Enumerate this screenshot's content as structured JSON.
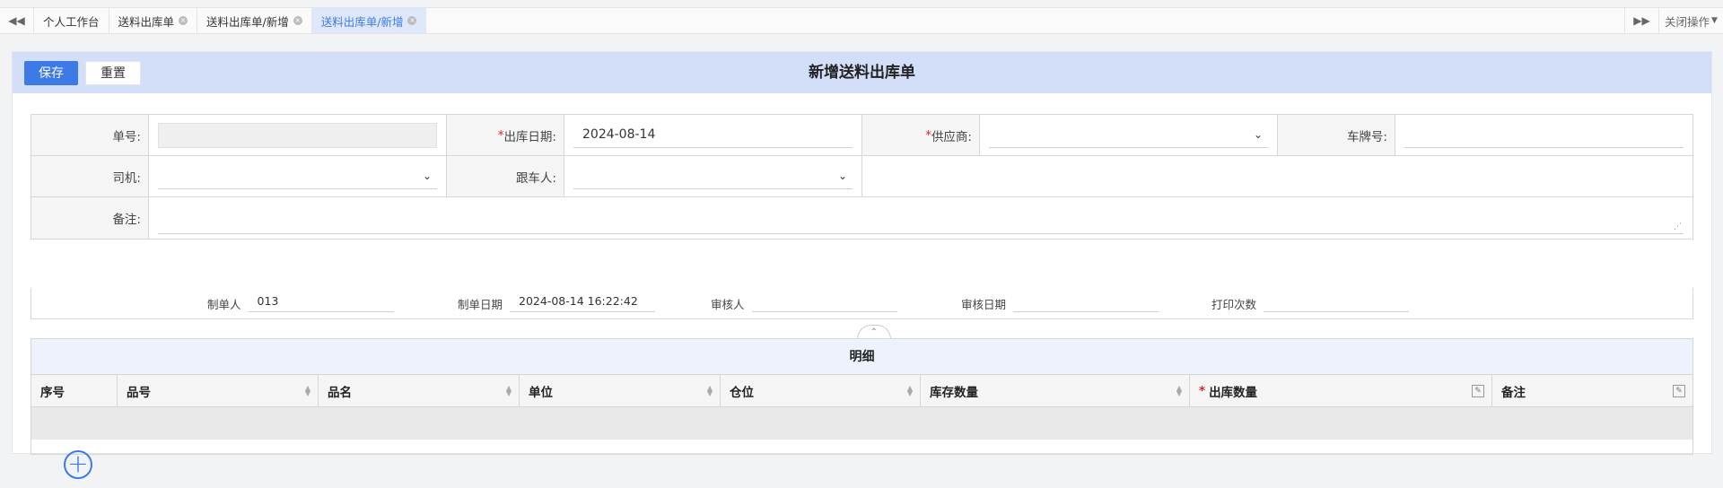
{
  "tabs": {
    "prev_icon": "double-left-icon",
    "items": [
      {
        "label": "个人工作台",
        "closable": false,
        "active": false
      },
      {
        "label": "送料出库单",
        "closable": true,
        "active": false
      },
      {
        "label": "送料出库单/新增",
        "closable": true,
        "active": false
      },
      {
        "label": "送料出库单/新增",
        "closable": true,
        "active": true
      }
    ],
    "next_icon": "double-right-icon",
    "close_ops_label": "关闭操作"
  },
  "toolbar": {
    "save_label": "保存",
    "reset_label": "重置",
    "title": "新增送料出库单"
  },
  "form": {
    "order_no": {
      "label": "单号:",
      "value": ""
    },
    "out_date": {
      "label": "出库日期:",
      "value": "2024-08-14",
      "required": true
    },
    "supplier": {
      "label": "供应商:",
      "value": "",
      "required": true
    },
    "plate_no": {
      "label": "车牌号:",
      "value": ""
    },
    "driver": {
      "label": "司机:",
      "value": ""
    },
    "escort": {
      "label": "跟车人:",
      "value": ""
    },
    "remark": {
      "label": "备注:",
      "value": ""
    }
  },
  "info": {
    "creator": {
      "label": "制单人",
      "value": "013"
    },
    "created_at": {
      "label": "制单日期",
      "value": "2024-08-14 16:22:42"
    },
    "reviewer": {
      "label": "审核人",
      "value": ""
    },
    "reviewed_at": {
      "label": "审核日期",
      "value": ""
    },
    "print_count": {
      "label": "打印次数",
      "value": ""
    }
  },
  "detail": {
    "title": "明细",
    "columns": [
      {
        "label": "序号",
        "sortable": false,
        "editable": false,
        "required": false
      },
      {
        "label": "品号",
        "sortable": true,
        "editable": false,
        "required": false
      },
      {
        "label": "品名",
        "sortable": true,
        "editable": false,
        "required": false
      },
      {
        "label": "单位",
        "sortable": true,
        "editable": false,
        "required": false
      },
      {
        "label": "仓位",
        "sortable": true,
        "editable": false,
        "required": false
      },
      {
        "label": "库存数量",
        "sortable": true,
        "editable": false,
        "required": false
      },
      {
        "label": "出库数量",
        "sortable": false,
        "editable": true,
        "required": true
      },
      {
        "label": "备注",
        "sortable": false,
        "editable": true,
        "required": false
      }
    ],
    "add_icon": "plus-circle-icon"
  }
}
